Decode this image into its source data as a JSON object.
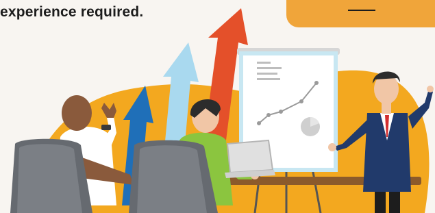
{
  "header": {
    "headline": "experience required."
  },
  "illustration": {
    "subject": "business-presentation",
    "colors": {
      "background": "#f8f5f1",
      "blob": "#f3a81f",
      "accent_orange": "#f0a53a",
      "arrow_red": "#e4502a",
      "arrow_light_blue": "#a9d9ef",
      "arrow_blue": "#1f6fb8",
      "suit": "#213a6b",
      "sweater": "#8bc53f",
      "chair": "#666a70"
    }
  }
}
